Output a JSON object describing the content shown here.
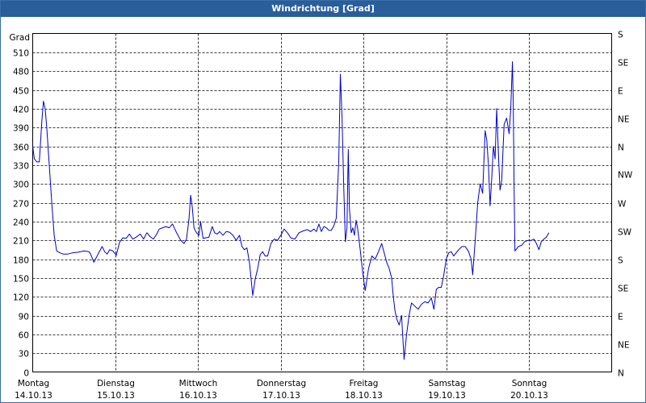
{
  "window": {
    "title": "Windrichtung [Grad]"
  },
  "chart_data": {
    "type": "line",
    "title": "Windrichtung [Grad]",
    "ylabel": "Grad",
    "ylim": [
      0,
      540
    ],
    "y_ticks": [
      0,
      30,
      60,
      90,
      120,
      150,
      180,
      210,
      240,
      270,
      300,
      330,
      360,
      390,
      420,
      450,
      480,
      510
    ],
    "right_ticks": [
      {
        "value": 0,
        "label": "N"
      },
      {
        "value": 45,
        "label": "NE"
      },
      {
        "value": 90,
        "label": "E"
      },
      {
        "value": 135,
        "label": "SE"
      },
      {
        "value": 180,
        "label": "S"
      },
      {
        "value": 225,
        "label": "SW"
      },
      {
        "value": 270,
        "label": "W"
      },
      {
        "value": 315,
        "label": "NW"
      },
      {
        "value": 360,
        "label": "N"
      },
      {
        "value": 405,
        "label": "NE"
      },
      {
        "value": 450,
        "label": "E"
      },
      {
        "value": 495,
        "label": "SE"
      },
      {
        "value": 540,
        "label": "S"
      }
    ],
    "x_labels": [
      {
        "day": "Montag",
        "date": "14.10.13"
      },
      {
        "day": "Dienstag",
        "date": "15.10.13"
      },
      {
        "day": "Mittwoch",
        "date": "16.10.13"
      },
      {
        "day": "Donnerstag",
        "date": "17.10.13"
      },
      {
        "day": "Freitag",
        "date": "18.10.13"
      },
      {
        "day": "Samstag",
        "date": "19.10.13"
      },
      {
        "day": "Sonntag",
        "date": "20.10.13"
      }
    ],
    "xlim": [
      0,
      7
    ],
    "grid": true,
    "line_color": "#0000cc",
    "series": [
      {
        "values": [
          [
            0.0,
            360
          ],
          [
            0.02,
            340
          ],
          [
            0.05,
            335
          ],
          [
            0.08,
            335
          ],
          [
            0.11,
            400
          ],
          [
            0.13,
            432
          ],
          [
            0.15,
            420
          ],
          [
            0.17,
            390
          ],
          [
            0.2,
            330
          ],
          [
            0.23,
            270
          ],
          [
            0.26,
            218
          ],
          [
            0.29,
            193
          ],
          [
            0.33,
            190
          ],
          [
            0.37,
            188
          ],
          [
            0.42,
            188
          ],
          [
            0.48,
            190
          ],
          [
            0.55,
            191
          ],
          [
            0.62,
            193
          ],
          [
            0.68,
            192
          ],
          [
            0.7,
            188
          ],
          [
            0.74,
            175
          ],
          [
            0.79,
            188
          ],
          [
            0.84,
            200
          ],
          [
            0.87,
            192
          ],
          [
            0.9,
            188
          ],
          [
            0.93,
            195
          ],
          [
            0.97,
            193
          ],
          [
            1.01,
            186
          ],
          [
            1.05,
            207
          ],
          [
            1.09,
            214
          ],
          [
            1.13,
            213
          ],
          [
            1.17,
            220
          ],
          [
            1.21,
            212
          ],
          [
            1.25,
            215
          ],
          [
            1.3,
            220
          ],
          [
            1.34,
            212
          ],
          [
            1.38,
            222
          ],
          [
            1.42,
            216
          ],
          [
            1.46,
            212
          ],
          [
            1.5,
            220
          ],
          [
            1.53,
            228
          ],
          [
            1.57,
            230
          ],
          [
            1.61,
            232
          ],
          [
            1.65,
            230
          ],
          [
            1.69,
            236
          ],
          [
            1.74,
            222
          ],
          [
            1.79,
            210
          ],
          [
            1.83,
            205
          ],
          [
            1.86,
            212
          ],
          [
            1.89,
            245
          ],
          [
            1.91,
            282
          ],
          [
            1.93,
            262
          ],
          [
            1.95,
            230
          ],
          [
            1.98,
            222
          ],
          [
            2.01,
            218
          ],
          [
            2.03,
            240
          ],
          [
            2.06,
            213
          ],
          [
            2.09,
            214
          ],
          [
            2.13,
            215
          ],
          [
            2.17,
            232
          ],
          [
            2.2,
            222
          ],
          [
            2.23,
            220
          ],
          [
            2.26,
            224
          ],
          [
            2.3,
            218
          ],
          [
            2.34,
            224
          ],
          [
            2.38,
            223
          ],
          [
            2.42,
            218
          ],
          [
            2.46,
            210
          ],
          [
            2.5,
            218
          ],
          [
            2.53,
            200
          ],
          [
            2.56,
            195
          ],
          [
            2.59,
            198
          ],
          [
            2.62,
            175
          ],
          [
            2.66,
            122
          ],
          [
            2.69,
            148
          ],
          [
            2.72,
            165
          ],
          [
            2.75,
            187
          ],
          [
            2.78,
            192
          ],
          [
            2.81,
            185
          ],
          [
            2.84,
            185
          ],
          [
            2.88,
            205
          ],
          [
            2.92,
            212
          ],
          [
            2.96,
            210
          ],
          [
            3.0,
            218
          ],
          [
            3.04,
            228
          ],
          [
            3.08,
            222
          ],
          [
            3.12,
            214
          ],
          [
            3.17,
            212
          ],
          [
            3.22,
            222
          ],
          [
            3.27,
            225
          ],
          [
            3.32,
            227
          ],
          [
            3.36,
            224
          ],
          [
            3.4,
            228
          ],
          [
            3.43,
            224
          ],
          [
            3.46,
            236
          ],
          [
            3.49,
            224
          ],
          [
            3.52,
            232
          ],
          [
            3.55,
            230
          ],
          [
            3.58,
            226
          ],
          [
            3.61,
            226
          ],
          [
            3.64,
            233
          ],
          [
            3.67,
            245
          ],
          [
            3.7,
            335
          ],
          [
            3.72,
            475
          ],
          [
            3.74,
            405
          ],
          [
            3.76,
            300
          ],
          [
            3.78,
            208
          ],
          [
            3.8,
            230
          ],
          [
            3.815,
            355
          ],
          [
            3.83,
            260
          ],
          [
            3.85,
            222
          ],
          [
            3.87,
            230
          ],
          [
            3.89,
            218
          ],
          [
            3.91,
            242
          ],
          [
            3.93,
            228
          ],
          [
            3.96,
            195
          ],
          [
            3.99,
            158
          ],
          [
            4.02,
            130
          ],
          [
            4.06,
            165
          ],
          [
            4.1,
            185
          ],
          [
            4.14,
            180
          ],
          [
            4.18,
            192
          ],
          [
            4.22,
            205
          ],
          [
            4.25,
            190
          ],
          [
            4.28,
            175
          ],
          [
            4.31,
            165
          ],
          [
            4.34,
            150
          ],
          [
            4.36,
            120
          ],
          [
            4.38,
            98
          ],
          [
            4.4,
            85
          ],
          [
            4.43,
            75
          ],
          [
            4.46,
            90
          ],
          [
            4.49,
            20
          ],
          [
            4.52,
            60
          ],
          [
            4.55,
            90
          ],
          [
            4.58,
            110
          ],
          [
            4.62,
            105
          ],
          [
            4.66,
            100
          ],
          [
            4.7,
            108
          ],
          [
            4.74,
            112
          ],
          [
            4.78,
            110
          ],
          [
            4.82,
            118
          ],
          [
            4.85,
            100
          ],
          [
            4.88,
            132
          ],
          [
            4.91,
            135
          ],
          [
            4.94,
            135
          ],
          [
            4.97,
            155
          ],
          [
            5.0,
            180
          ],
          [
            5.03,
            190
          ],
          [
            5.06,
            192
          ],
          [
            5.09,
            185
          ],
          [
            5.12,
            190
          ],
          [
            5.15,
            195
          ],
          [
            5.19,
            200
          ],
          [
            5.23,
            200
          ],
          [
            5.27,
            192
          ],
          [
            5.3,
            180
          ],
          [
            5.32,
            155
          ],
          [
            5.35,
            210
          ],
          [
            5.38,
            270
          ],
          [
            5.41,
            300
          ],
          [
            5.44,
            285
          ],
          [
            5.47,
            385
          ],
          [
            5.49,
            370
          ],
          [
            5.51,
            330
          ],
          [
            5.53,
            265
          ],
          [
            5.55,
            310
          ],
          [
            5.57,
            360
          ],
          [
            5.59,
            340
          ],
          [
            5.61,
            420
          ],
          [
            5.63,
            350
          ],
          [
            5.65,
            290
          ],
          [
            5.67,
            305
          ],
          [
            5.7,
            395
          ],
          [
            5.73,
            405
          ],
          [
            5.76,
            380
          ],
          [
            5.78,
            420
          ],
          [
            5.8,
            495
          ],
          [
            5.81,
            430
          ],
          [
            5.82,
            300
          ],
          [
            5.83,
            193
          ],
          [
            5.87,
            200
          ],
          [
            5.91,
            202
          ],
          [
            5.95,
            208
          ],
          [
            5.99,
            210
          ],
          [
            6.03,
            210
          ],
          [
            6.06,
            212
          ],
          [
            6.09,
            205
          ],
          [
            6.12,
            195
          ],
          [
            6.15,
            208
          ],
          [
            6.18,
            212
          ],
          [
            6.21,
            215
          ],
          [
            6.24,
            222
          ]
        ]
      }
    ]
  }
}
